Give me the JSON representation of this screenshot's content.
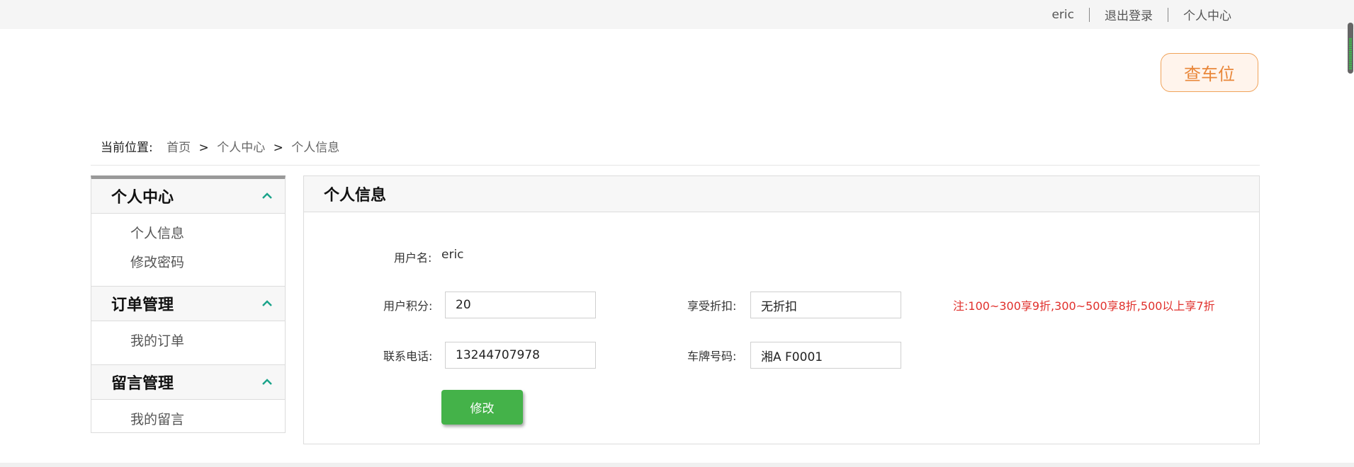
{
  "topbar": {
    "username": "eric",
    "logout": "退出登录",
    "user_center": "个人中心"
  },
  "park_button": "查车位",
  "breadcrumb": {
    "lead": "当前位置:",
    "items": [
      "首页",
      "个人中心",
      "个人信息"
    ],
    "separator": ">"
  },
  "sidebar": {
    "groups": [
      {
        "title": "个人中心",
        "items": [
          "个人信息",
          "修改密码"
        ]
      },
      {
        "title": "订单管理",
        "items": [
          "我的订单"
        ]
      },
      {
        "title": "留言管理",
        "items": [
          "我的留言"
        ]
      }
    ]
  },
  "panel": {
    "title": "个人信息",
    "username_label": "用户名:",
    "username_value": "eric",
    "points_label": "用户积分:",
    "points_value": "20",
    "discount_label": "享受折扣:",
    "discount_value": "无折扣",
    "note": "注:100~300享9折,300~500享8折,500以上享7折",
    "phone_label": "联系电话:",
    "phone_value": "13244707978",
    "plate_label": "车牌号码:",
    "plate_value": "湘A F0001",
    "submit_label": "修改"
  },
  "colors": {
    "accent_green": "#44b249",
    "chevron_teal": "#1aa38a",
    "park_orange": "#e9873a",
    "note_red": "#e0302c"
  }
}
